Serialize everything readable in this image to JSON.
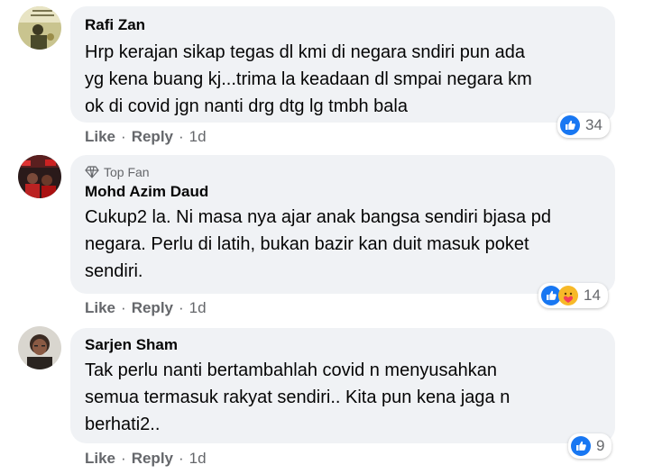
{
  "comments": [
    {
      "author": "Rafi Zan",
      "badge": "",
      "text": "Hrp kerajan sikap tegas dl kmi di negara sndiri pun ada\nyg kena buang kj...trima la keadaan dl smpai negara km\nok di covid jgn nanti drg dtg lg tmbh bala",
      "like_label": "Like",
      "reply_label": "Reply",
      "time": "1d",
      "reaction_count": "34",
      "reactions": [
        "like-icon"
      ]
    },
    {
      "author": "Mohd Azim Daud",
      "badge": "Top Fan",
      "text": "Cukup2 la. Ni masa nya ajar anak bangsa sendiri bjasa pd\nnegara. Perlu di latih, bukan bazir kan duit masuk poket\nsendiri.",
      "like_label": "Like",
      "reply_label": "Reply",
      "time": "1d",
      "reaction_count": "14",
      "reactions": [
        "like-icon",
        "care-icon"
      ]
    },
    {
      "author": "Sarjen Sham",
      "badge": "",
      "text": "Tak perlu nanti bertambahlah covid n menyusahkan\nsemua termasuk rakyat sendiri.. Kita pun kena jaga n\nberhati2..",
      "like_label": "Like",
      "reply_label": "Reply",
      "time": "1d",
      "reaction_count": "9",
      "reactions": [
        "like-icon"
      ]
    }
  ],
  "colors": {
    "bubble": "#f0f2f5",
    "meta": "#65676b",
    "like_blue": "#1877f2",
    "care_yellow": "#f7b928"
  }
}
